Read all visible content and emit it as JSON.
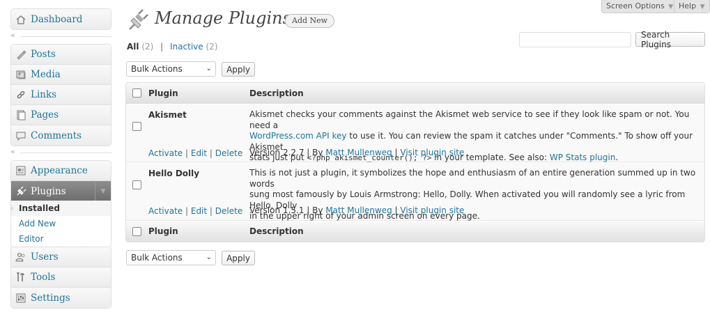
{
  "sidebar": {
    "dashboard": {
      "label": "Dashboard",
      "icon": "dashboard-icon"
    },
    "group2": [
      {
        "label": "Posts",
        "icon": "posts-icon"
      },
      {
        "label": "Media",
        "icon": "media-icon"
      },
      {
        "label": "Links",
        "icon": "links-icon"
      },
      {
        "label": "Pages",
        "icon": "pages-icon"
      },
      {
        "label": "Comments",
        "icon": "comments-icon"
      }
    ],
    "appearance": {
      "label": "Appearance",
      "icon": "appearance-icon"
    },
    "plugins": {
      "label": "Plugins",
      "icon": "plugins-icon",
      "submenu": [
        "Installed",
        "Add New",
        "Editor"
      ]
    },
    "group3": [
      {
        "label": "Users",
        "icon": "users-icon"
      },
      {
        "label": "Tools",
        "icon": "tools-icon"
      },
      {
        "label": "Settings",
        "icon": "settings-icon"
      }
    ],
    "separator_glyph": "«"
  },
  "header": {
    "title": "Manage Plugins",
    "add_new": "Add New",
    "screen_options": "Screen Options",
    "help": "Help"
  },
  "filters": {
    "all": "All",
    "all_count": "(2)",
    "separator": "|",
    "inactive": "Inactive",
    "inactive_count": "(2)"
  },
  "search": {
    "button": "Search Plugins",
    "value": ""
  },
  "bulk": {
    "select": "Bulk Actions",
    "apply": "Apply"
  },
  "table": {
    "col_plugin": "Plugin",
    "col_description": "Description",
    "rows": [
      {
        "name": "Akismet",
        "actions": [
          "Activate",
          "Edit",
          "Delete"
        ],
        "desc_1": "Akismet checks your comments against the Akismet web service to see if they look like spam or not. You need a",
        "desc_link": "WordPress.com API key",
        "desc_2": " to use it. You can review the spam it catches under \"Comments.\" To show off your Akismet",
        "desc_3": "stats just put ",
        "desc_code": "<?php akismet_counter(); ?>",
        "desc_4": " in your template. See also: ",
        "desc_link2": "WP Stats plugin",
        "desc_5": ".",
        "version": "Version 2.2.7",
        "by": "By",
        "author": "Matt Mullenweg",
        "site": "Visit plugin site"
      },
      {
        "name": "Hello Dolly",
        "actions": [
          "Activate",
          "Edit",
          "Delete"
        ],
        "desc_1": "This is not just a plugin, it symbolizes the hope and enthusiasm of an entire generation summed up in two words",
        "desc_2": "sung most famously by Louis Armstrong: Hello, Dolly. When activated you will randomly see a lyric from Hello, Dolly",
        "desc_3": "in the upper right of your admin screen on every page.",
        "version": "Version 1.5.1",
        "by": "By",
        "author": "Matt Mullenweg",
        "site": "Visit plugin site"
      }
    ]
  }
}
